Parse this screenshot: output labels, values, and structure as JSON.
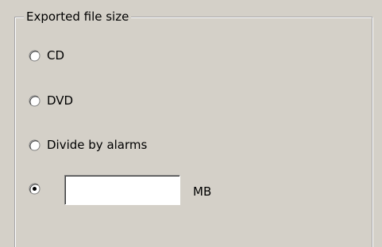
{
  "group": {
    "title": "Exported file size"
  },
  "options": [
    {
      "label": "CD",
      "selected": false
    },
    {
      "label": "DVD",
      "selected": false
    },
    {
      "label": "Divide by alarms",
      "selected": false
    },
    {
      "label": "",
      "selected": true
    }
  ],
  "custom_size": {
    "value": "",
    "unit": "MB"
  },
  "colors": {
    "background": "#d4d0c8",
    "field": "#ffffff"
  }
}
